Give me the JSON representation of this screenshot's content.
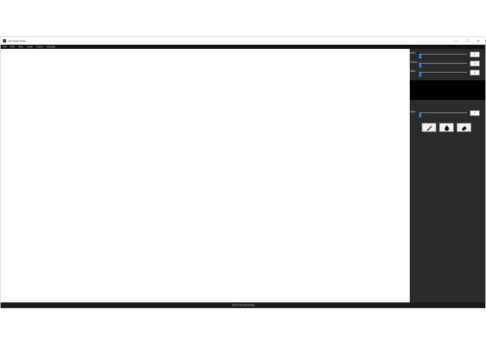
{
  "window": {
    "title": "Jot Down Pad"
  },
  "menubar": {
    "items": [
      "File",
      "Edit",
      "View",
      "Tools",
      "Colors",
      "Window"
    ]
  },
  "color_sliders": [
    {
      "label": "Red",
      "value": "0",
      "fraction": 0
    },
    {
      "label": "Green",
      "value": "0",
      "fraction": 0
    },
    {
      "label": "Blue",
      "value": "0",
      "fraction": 0
    }
  ],
  "preview_color": "#000000",
  "size_slider": {
    "label": "Size",
    "value": "1",
    "fraction": 0
  },
  "tools": [
    {
      "name": "pen-icon"
    },
    {
      "name": "fill-icon"
    },
    {
      "name": "eraser-icon"
    }
  ],
  "status": {
    "text": "100%   Not Recording"
  },
  "colors": {
    "menubar": "#121212",
    "side_panel": "#2b2b2b",
    "slider_thumb": "#1e90ff",
    "statusbar": "#1a1a1a"
  }
}
